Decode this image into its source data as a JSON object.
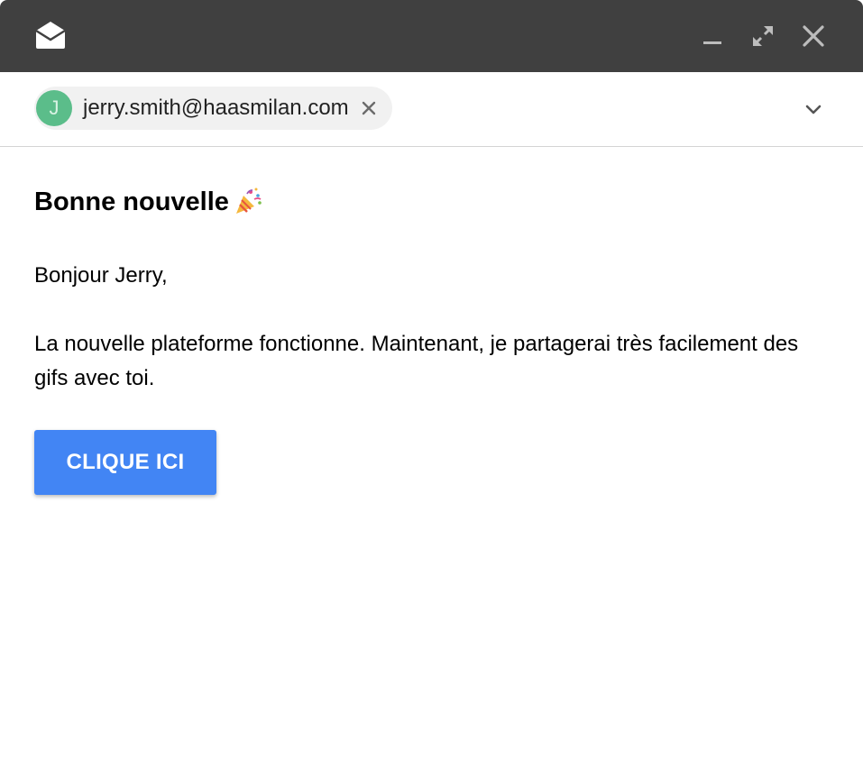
{
  "window": {
    "app_icon": "envelope-open-icon",
    "controls": [
      "minimize-icon",
      "expand-icon",
      "close-icon"
    ],
    "titlebar_color": "#404040"
  },
  "recipient": {
    "avatar_initial": "J",
    "avatar_color": "#5bbd8a",
    "email": "jerry.smith@haasmilan.com",
    "remove_icon": "close-icon",
    "dropdown_icon": "chevron-down-icon"
  },
  "message": {
    "subject": "Bonne nouvelle",
    "subject_emoji": "party-popper-icon",
    "greeting": "Bonjour Jerry,",
    "body": "La nouvelle plateforme fonctionne. Maintenant, je partagerai très facilement des gifs avec toi.",
    "cta_label": "CLIQUE ICI",
    "cta_color": "#4285f4"
  }
}
